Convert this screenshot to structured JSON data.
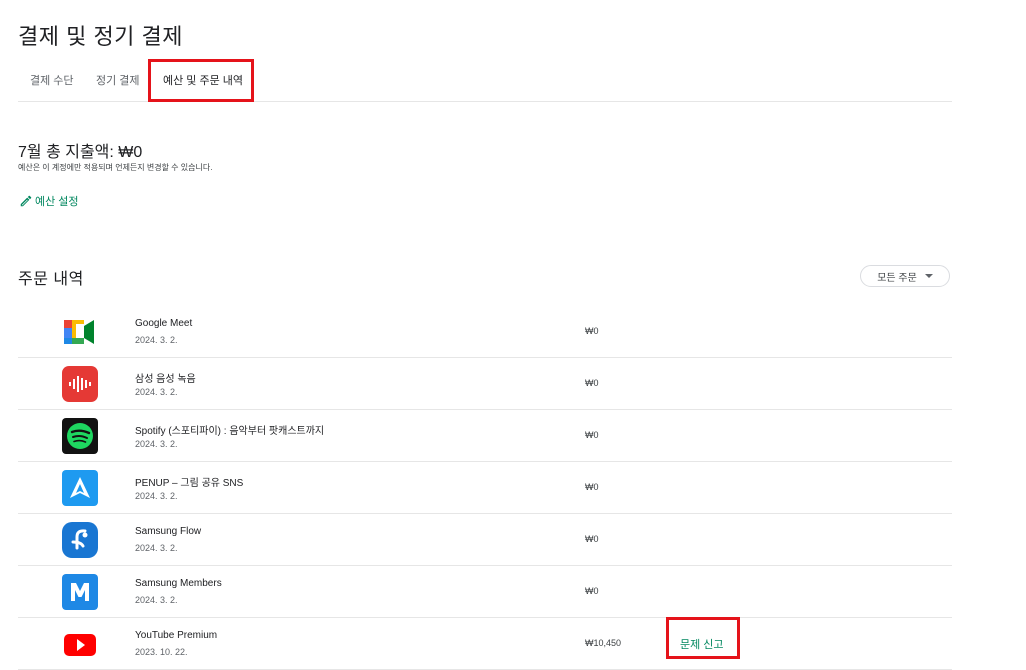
{
  "page": {
    "title": "결제 및 정기 결제"
  },
  "tabs": [
    {
      "label": "결제 수단"
    },
    {
      "label": "정기 결제"
    },
    {
      "label": "예산 및 주문 내역"
    }
  ],
  "budget": {
    "spend_title": "7월 총 지출액: ₩0",
    "note": "예산은 이 계정에만 적용되며 언제든지 변경할 수 있습니다.",
    "set_link": "예산 설정"
  },
  "orders": {
    "title": "주문 내역",
    "filter_label": "모든 주문",
    "items": [
      {
        "name": "Google Meet",
        "date": "2024. 3. 2.",
        "price": "₩0",
        "icon": "google-meet-icon"
      },
      {
        "name": "삼성 음성 녹음",
        "date": "2024. 3. 2.",
        "price": "₩0",
        "icon": "samsung-voice-recorder-icon"
      },
      {
        "name": "Spotify (스포티파이) : 음악부터 팟캐스트까지",
        "date": "2024. 3. 2.",
        "price": "₩0",
        "icon": "spotify-icon"
      },
      {
        "name": "PENUP – 그림 공유 SNS",
        "date": "2024. 3. 2.",
        "price": "₩0",
        "icon": "penup-icon"
      },
      {
        "name": "Samsung Flow",
        "date": "2024. 3. 2.",
        "price": "₩0",
        "icon": "samsung-flow-icon"
      },
      {
        "name": "Samsung Members",
        "date": "2024. 3. 2.",
        "price": "₩0",
        "icon": "samsung-members-icon"
      },
      {
        "name": "YouTube Premium",
        "date": "2023. 10. 22.",
        "price": "₩10,450",
        "icon": "youtube-icon",
        "report_label": "문제 신고"
      }
    ]
  },
  "colors": {
    "accent": "#01875f",
    "highlight": "#e5131a"
  }
}
